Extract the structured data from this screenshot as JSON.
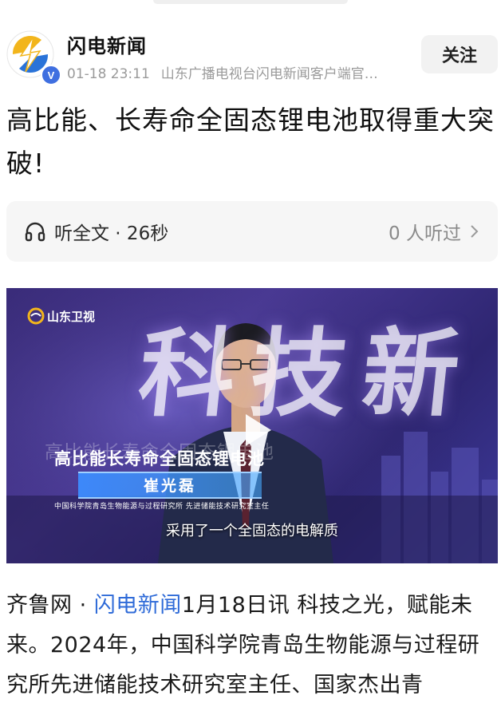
{
  "header": {
    "author_name": "闪电新闻",
    "timestamp": "01-18 23:11",
    "source": "山东广播电视台闪电新闻客户端官…",
    "follow_label": "关注",
    "verified_badge": "V"
  },
  "article": {
    "title": "高比能、长寿命全固态锂电池取得重大突破!"
  },
  "listen": {
    "label": "听全文 · 26秒",
    "count_label": "0 人听过",
    "icon": "headphones-icon"
  },
  "video": {
    "watermark": "山东卫视",
    "background_text": "科技新",
    "ghost_caption": "高比能长寿命全固态锂电池",
    "lower_third_title": "高比能长寿命全固态锂电池",
    "person_name": "崔光磊",
    "person_org": "中国科学院青岛生物能源与过程研究所 先进储能技术研究室主任",
    "subtitle": "采用了一个全固态的电解质"
  },
  "body": {
    "prefix": "齐鲁网 · ",
    "link_text": "闪电新闻",
    "text": "1月18日讯  科技之光，赋能未来。2024年，中国科学院青岛生物能源与过程研究所先进储能技术研究室主任、国家杰出青"
  },
  "colors": {
    "link": "#2f6bd8",
    "accent_blue": "#3f6fe0",
    "avatar_yellow": "#f2b51c"
  }
}
